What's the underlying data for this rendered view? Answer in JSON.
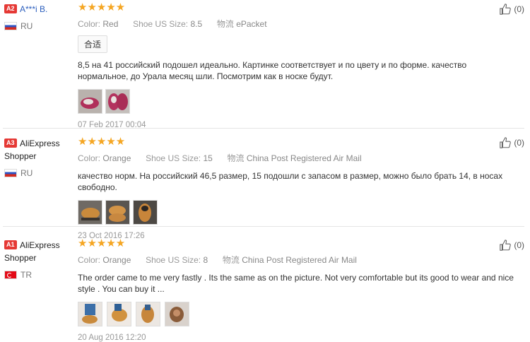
{
  "reviews": [
    {
      "level": "A2",
      "name": "A***i B.",
      "country": "RU",
      "stars": "★★★★★",
      "color_label": "Color:",
      "color": "Red",
      "size_label": "Shoe US Size:",
      "size": "8.5",
      "ship_label": "物流",
      "ship": "ePacket",
      "tag": "合适",
      "text": "8,5 на 41 российский подошел идеально. Картинке соответствует и по цвету и по форме. качество нормальное, до Урала месяц шли. Посмотрим как в носке будут.",
      "date": "07 Feb 2017 00:04",
      "likes": "(0)"
    },
    {
      "level": "A3",
      "name": "AliExpress Shopper",
      "country": "RU",
      "stars": "★★★★★",
      "color_label": "Color:",
      "color": "Orange",
      "size_label": "Shoe US Size:",
      "size": "15",
      "ship_label": "物流",
      "ship": "China Post Registered Air Mail",
      "text": "качество норм. На российский 46,5 размер, 15 подошли с запасом в размер, можно было брать 14, в носах свободно.",
      "date": "23 Oct 2016 17:26",
      "likes": "(0)"
    },
    {
      "level": "A1",
      "name": "AliExpress Shopper",
      "country": "TR",
      "stars": "★★★★★",
      "color_label": "Color:",
      "color": "Orange",
      "size_label": "Shoe US Size:",
      "size": "8",
      "ship_label": "物流",
      "ship": "China Post Registered Air Mail",
      "text": "The order came to me very fastly . Its the same as on the picture. Not very comfortable but its good to wear and nice style . You can buy it ...",
      "date": "20 Aug 2016 12:20",
      "likes": "(0)"
    }
  ],
  "colors": {
    "star": "#f5a623",
    "level_badge": "#e53935",
    "name_link": "#2b5ebd"
  },
  "icons": {
    "like": "thumbs-up-icon",
    "flag_ru": "russia-flag-icon",
    "flag_tr": "turkey-flag-icon"
  }
}
